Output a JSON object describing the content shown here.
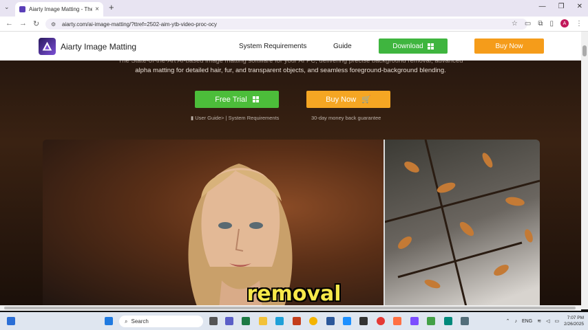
{
  "browser": {
    "tab_title": "Aiarty Image Matting - The Sta",
    "url": "aiarty.com/ai-image-matting/?ttref=2502-aim-ytb-video-proc-ocy",
    "profile_initial": "A"
  },
  "site": {
    "brand": "Aiarty Image Matting",
    "nav": [
      "System Requirements",
      "Guide"
    ],
    "download_label": "Download",
    "buy_label": "Buy Now"
  },
  "hero": {
    "desc_line1": "The State-of-the-Art AI-based image matting software for your AI PC, delivering precise background removal, advanced",
    "desc_line2": "alpha matting for detailed hair, fur, and transparent objects, and seamless foreground-background blending.",
    "trial_label": "Free Trial",
    "buy_label": "Buy Now",
    "guide_links": "User Guide> | System Requirements",
    "guarantee": "30-day money back guarantee"
  },
  "caption": "removal",
  "taskbar": {
    "search_placeholder": "Search",
    "language": "ENG",
    "time": "7:07 PM",
    "date": "2/26/2025"
  },
  "colors": {
    "green": "#3fb53f",
    "orange": "#f59c1a",
    "caption": "#f7e84a"
  }
}
